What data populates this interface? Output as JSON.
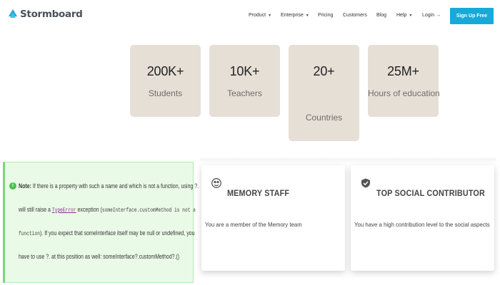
{
  "nav": {
    "logo_text": "Stormboard",
    "items": [
      {
        "label": "Product",
        "caret": true
      },
      {
        "label": "Enterprise",
        "caret": true
      },
      {
        "label": "Pricing",
        "caret": false
      },
      {
        "label": "Customers",
        "caret": false
      },
      {
        "label": "Blog",
        "caret": false
      },
      {
        "label": "Help",
        "caret": true
      },
      {
        "label": "Login →",
        "caret": false
      }
    ],
    "signup_label": "Sign Up Free",
    "signup_color": "#16aad8"
  },
  "stats": [
    {
      "value": "200K+",
      "label": "Students"
    },
    {
      "value": "10K+",
      "label": "Teachers"
    },
    {
      "value": "20+",
      "label": "Countries"
    },
    {
      "value": "25M+",
      "label": "Hours of education"
    }
  ],
  "note": {
    "icon": "info-icon",
    "label": "Note:",
    "line1": "If there is a property with such a name and which is not a function, using ?.",
    "line2_a": "will still raise a",
    "line2_code": "TypeError",
    "line2_b": "exception (",
    "line2_code2": "someInterface.customMethod is not a",
    "line3_code": "function",
    "line3_b": "). If you expect that someInterface itself may be null or undefined, you",
    "line4": "have to use ?. at this position as well: someInterface?.customMethod?.()"
  },
  "cards": [
    {
      "icon": "memory-badge-icon",
      "title": "MEMORY STAFF",
      "desc": "You are a member of the Memory team"
    },
    {
      "icon": "shield-check-icon",
      "title": "TOP SOCIAL CONTRIBUTOR",
      "desc": "You have a high contribution level to the social aspects"
    }
  ]
}
